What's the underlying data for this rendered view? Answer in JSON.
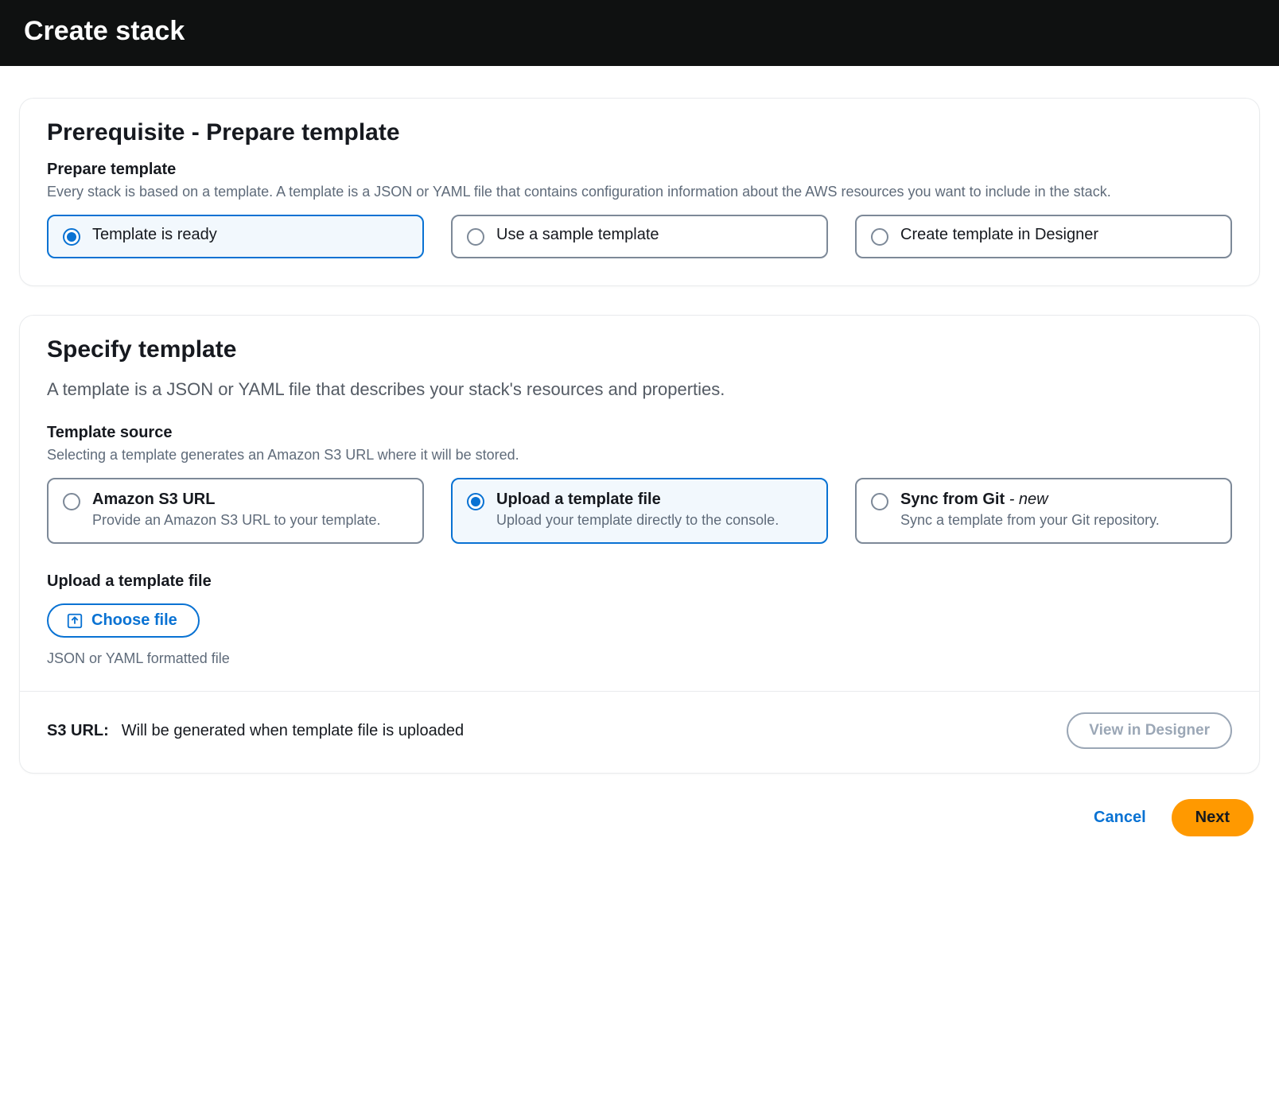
{
  "header": {
    "title": "Create stack"
  },
  "prereq": {
    "title": "Prerequisite - Prepare template",
    "field_label": "Prepare template",
    "field_help": "Every stack is based on a template. A template is a JSON or YAML file that contains configuration information about the AWS resources you want to include in the stack.",
    "options": [
      {
        "label": "Template is ready"
      },
      {
        "label": "Use a sample template"
      },
      {
        "label": "Create template in Designer"
      }
    ]
  },
  "specify": {
    "title": "Specify template",
    "subtitle": "A template is a JSON or YAML file that describes your stack's resources and properties.",
    "source_label": "Template source",
    "source_help": "Selecting a template generates an Amazon S3 URL where it will be stored.",
    "options": [
      {
        "label": "Amazon S3 URL",
        "desc": "Provide an Amazon S3 URL to your template."
      },
      {
        "label": "Upload a template file",
        "desc": "Upload your template directly to the console."
      },
      {
        "label": "Sync from Git",
        "new": "- new",
        "desc": "Sync a template from your Git repository."
      }
    ],
    "upload_label": "Upload a template file",
    "choose_file": "Choose file",
    "file_hint": "JSON or YAML formatted file",
    "s3_label": "S3 URL:",
    "s3_value": "Will be generated when template file is uploaded",
    "view_designer": "View in Designer"
  },
  "footer": {
    "cancel": "Cancel",
    "next": "Next"
  }
}
